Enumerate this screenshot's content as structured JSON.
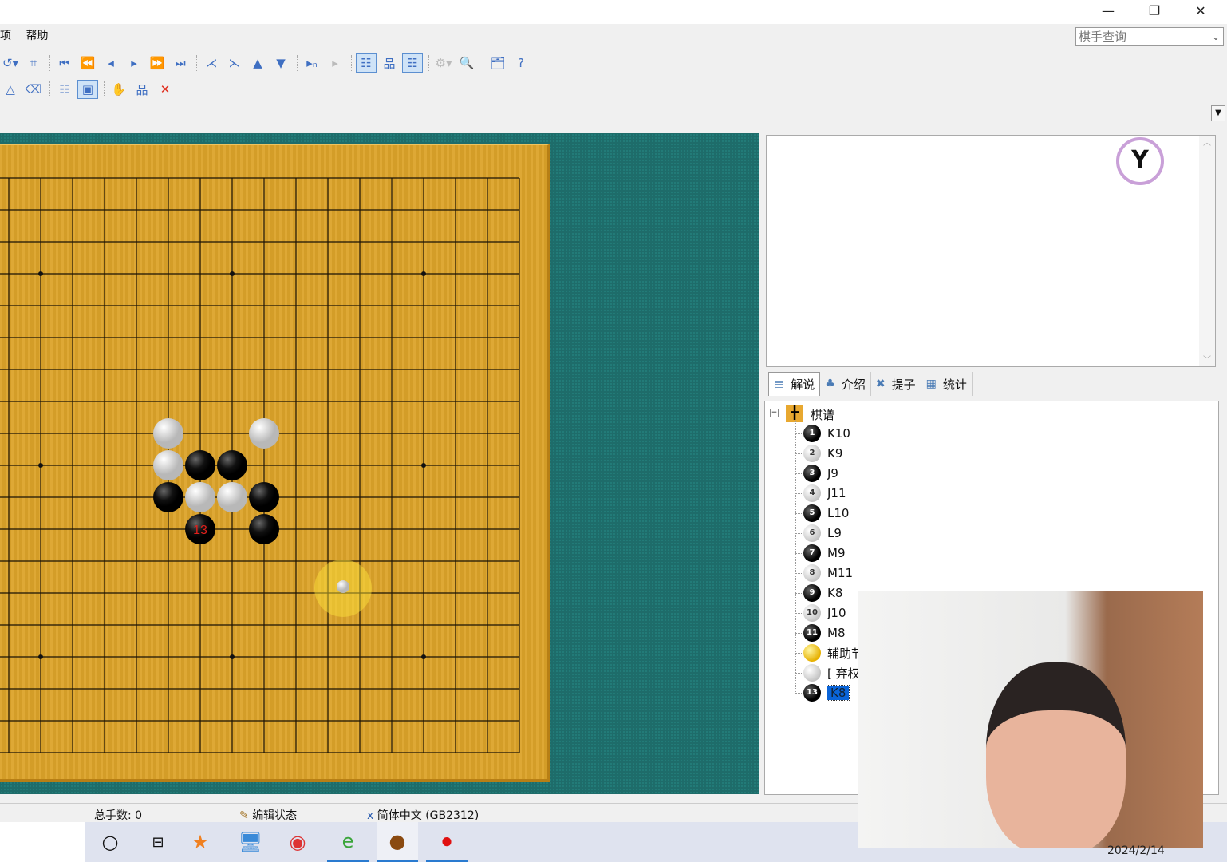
{
  "window": {
    "minimize": "—",
    "restore": "❐",
    "close": "✕"
  },
  "menu": [
    "项",
    "帮助"
  ],
  "player_search": {
    "value": "棋手查询"
  },
  "toolbar_row1": [
    {
      "name": "undo",
      "g": "↺▾"
    },
    {
      "name": "board-size",
      "g": "⌗"
    },
    {
      "sep": true
    },
    {
      "name": "first-move",
      "g": "⏮"
    },
    {
      "name": "fast-back",
      "g": "⏪"
    },
    {
      "name": "back",
      "g": "◂"
    },
    {
      "name": "forward",
      "g": "▸"
    },
    {
      "name": "fast-forward",
      "g": "⏩"
    },
    {
      "name": "last-move",
      "g": "⏭"
    },
    {
      "sep": true
    },
    {
      "name": "prev-variation",
      "g": "⋌"
    },
    {
      "name": "next-variation",
      "g": "⋋"
    },
    {
      "name": "up",
      "g": "▲"
    },
    {
      "name": "down",
      "g": "▼"
    },
    {
      "sep": true
    },
    {
      "name": "goto-move",
      "g": "▸ₙ"
    },
    {
      "name": "goto-comment",
      "g": "▸",
      "dis": true
    },
    {
      "sep": true
    },
    {
      "name": "tree-view",
      "g": "☷",
      "on": true
    },
    {
      "name": "tree-branch",
      "g": "品"
    },
    {
      "name": "tree-jump",
      "g": "☷",
      "on": true
    },
    {
      "sep": true
    },
    {
      "name": "analysis",
      "g": "⚙▾",
      "dis": true
    },
    {
      "name": "search",
      "g": "🔍"
    },
    {
      "sep": true
    },
    {
      "name": "properties",
      "g": "🗂"
    },
    {
      "name": "help",
      "g": "?"
    }
  ],
  "toolbar_row2": [
    {
      "name": "triangle",
      "g": "△"
    },
    {
      "name": "eraser",
      "g": "⌫"
    },
    {
      "sep": true
    },
    {
      "name": "new-node",
      "g": "☷"
    },
    {
      "name": "edit-node",
      "g": "▣",
      "on": true
    },
    {
      "sep": true
    },
    {
      "name": "hand",
      "g": "✋"
    },
    {
      "name": "tree-structure",
      "g": "品"
    },
    {
      "name": "delete",
      "g": "✕"
    }
  ],
  "board": {
    "size": 19,
    "white": [
      [
        7,
        8
      ],
      [
        10,
        8
      ],
      [
        7,
        9
      ],
      [
        8,
        10
      ],
      [
        9,
        10
      ]
    ],
    "black": [
      [
        8,
        9
      ],
      [
        9,
        9
      ],
      [
        7,
        10
      ],
      [
        10,
        10
      ],
      [
        8,
        11
      ],
      [
        10,
        11
      ]
    ],
    "last_move": {
      "col": 8,
      "row": 11,
      "label": "13"
    },
    "label_color": "#e0201c"
  },
  "tabs": [
    {
      "label": "解说",
      "icon": "comment"
    },
    {
      "label": "介绍",
      "icon": "players"
    },
    {
      "label": "提子",
      "icon": "captures"
    },
    {
      "label": "统计",
      "icon": "stats"
    }
  ],
  "tree": {
    "root": "棋谱",
    "nodes": [
      {
        "n": "1",
        "c": "b",
        "label": "K10"
      },
      {
        "n": "2",
        "c": "w",
        "label": "K9"
      },
      {
        "n": "3",
        "c": "b",
        "label": "J9"
      },
      {
        "n": "4",
        "c": "w",
        "label": "J11"
      },
      {
        "n": "5",
        "c": "b",
        "label": "L10"
      },
      {
        "n": "6",
        "c": "w",
        "label": "L9"
      },
      {
        "n": "7",
        "c": "b",
        "label": "M9"
      },
      {
        "n": "8",
        "c": "w",
        "label": "M11"
      },
      {
        "n": "9",
        "c": "b",
        "label": "K8"
      },
      {
        "n": "10",
        "c": "w",
        "label": "J10"
      },
      {
        "n": "11",
        "c": "b",
        "label": "M8"
      },
      {
        "n": "",
        "c": "y",
        "label": "辅助节"
      },
      {
        "n": "",
        "c": "w",
        "label": "[ 弃权"
      },
      {
        "n": "13",
        "c": "b",
        "label": "K8",
        "selected": true
      }
    ]
  },
  "status": {
    "moves": "总手数: 0",
    "mode": "编辑状态",
    "encoding": "简体中文 (GB2312)"
  },
  "taskbar": {
    "date": "2024/2/14"
  }
}
